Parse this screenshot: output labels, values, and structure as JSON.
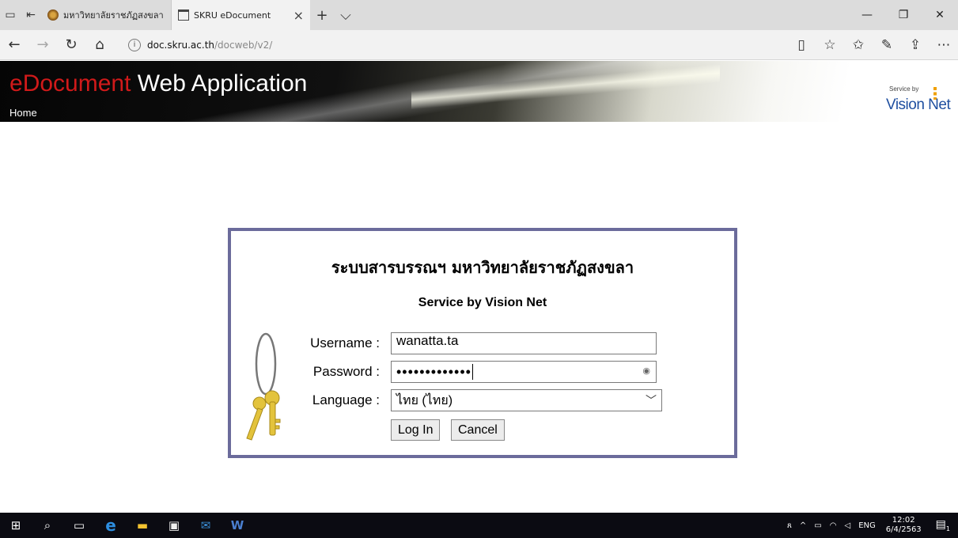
{
  "browser": {
    "tabs": [
      {
        "title": "มหาวิทยาลัยราชภัฏสงขลา :: So",
        "active": false
      },
      {
        "title": "SKRU eDocument",
        "active": true
      }
    ],
    "address": {
      "host": "doc.skru.ac.th",
      "path": "/docweb/v2/"
    },
    "icons": {
      "tab_actions": "tab-actions-icon",
      "set_aside": "set-aside-icon",
      "back": "back-arrow-icon",
      "forward": "forward-arrow-icon",
      "refresh": "refresh-icon",
      "home": "home-icon",
      "reading_view": "reading-view-icon",
      "favorite": "star-icon",
      "favorites": "favorites-list-icon",
      "notes": "pen-icon",
      "share": "share-icon",
      "more": "more-icon"
    }
  },
  "banner": {
    "title_accent": "e",
    "title_accent2": "Document",
    "title_rest": " Web Application",
    "nav_home": "Home",
    "logo_service": "Service by",
    "logo_brand": "Vision Net"
  },
  "login": {
    "heading": "ระบบสารบรรณฯ มหาวิทยาลัยราชภัฏสงขลา",
    "subheading": "Service by Vision Net",
    "username_label": "Username :",
    "username_value": "wanatta.ta",
    "password_label": "Password :",
    "password_mask": "•••••••••••••",
    "language_label": "Language :",
    "language_value": "ไทย (ไทย)",
    "login_button": "Log In",
    "cancel_button": "Cancel"
  },
  "taskbar": {
    "lang": "ENG",
    "time": "12:02",
    "date": "6/4/2563",
    "notifications": "1"
  },
  "colors": {
    "accent_red": "#d01a1a",
    "panel_border": "#6b6b9b",
    "brand_blue": "#1f4fa0"
  }
}
